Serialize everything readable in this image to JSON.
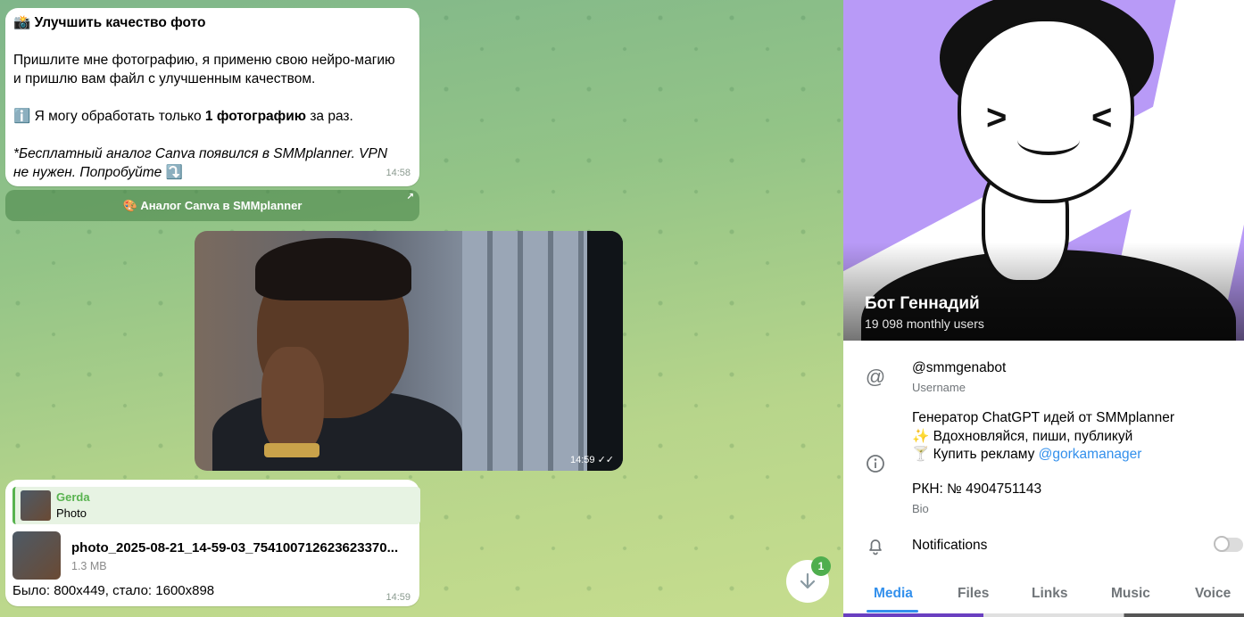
{
  "chat": {
    "message1": {
      "title_emoji": "📸",
      "title": "Улучшить качество фото",
      "line1": "Пришлите мне фотографию, я применю свою нейро-магию",
      "line2": "и пришлю вам файл с улучшенным качеством.",
      "info_emoji": "ℹ️",
      "info_pre": "Я могу обработать только ",
      "info_bold": "1 фотографию",
      "info_post": " за раз.",
      "promo": "*Бесплатный аналог Canva появился в SMMplanner. VPN не нужен. Попробуйте",
      "promo_emoji": "⤵️",
      "time": "14:58"
    },
    "inline_button": {
      "emoji": "🎨",
      "label": "Аналог Canva в SMMplanner",
      "arrow": "↗"
    },
    "photo_message": {
      "time": "14:59",
      "ticks": "✓✓"
    },
    "message3": {
      "reply_name": "Gerda",
      "reply_text": "Photo",
      "file_name": "photo_2025-08-21_14-59-03_754100712623623370...",
      "file_size": "1.3 MB",
      "caption": "Было: 800x449, стало: 1600x898",
      "time": "14:59"
    },
    "scroll_down": {
      "icon": "arrow-down-icon",
      "unread_count": "1"
    }
  },
  "profile": {
    "bot_name": "Бот Геннадий",
    "monthly_users": "19 098 monthly users",
    "username": "@smmgenabot",
    "username_label": "Username",
    "bio_line1": "Генератор ChatGPT идей от SMMplanner",
    "bio_line2": "✨ Вдохновляйся, пиши, публикуй",
    "bio_line3_pre": "🍸 Купить рекламу ",
    "bio_line3_link": "@gorkamanager",
    "bio_line4": "РКН: № 4904751143",
    "bio_label": "Bio",
    "notifications_label": "Notifications",
    "notifications_on": false,
    "tabs": [
      "Media",
      "Files",
      "Links",
      "Music",
      "Voice"
    ],
    "active_tab": "Media",
    "accent_color": "#3390ec"
  }
}
